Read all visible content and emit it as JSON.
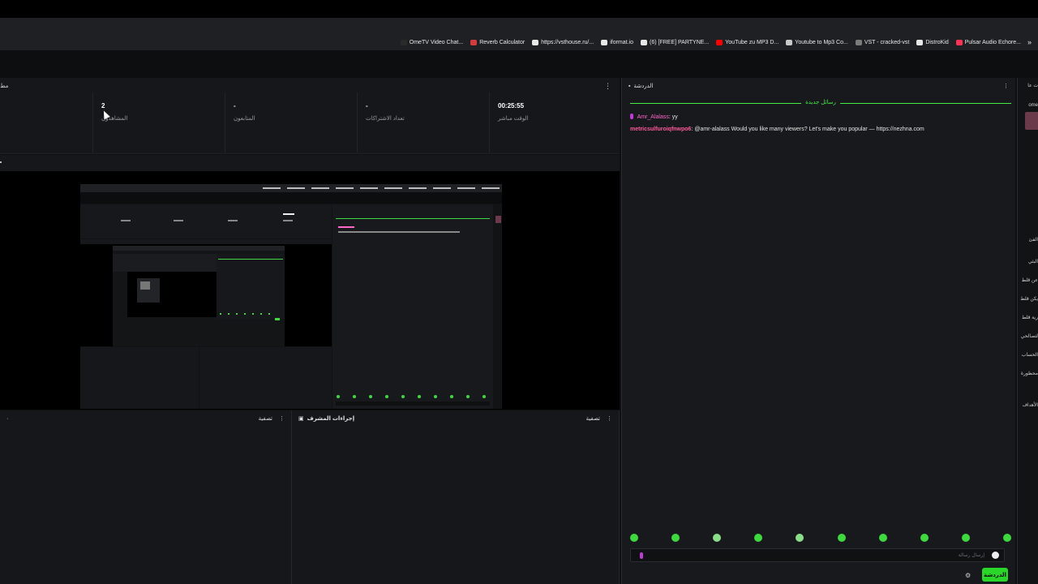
{
  "bookmarks": [
    {
      "label": "OmeTV Video Chat...",
      "icon": "page-icon",
      "color": "#2a2a2a"
    },
    {
      "label": "Reverb Calculator",
      "icon": "calc-icon",
      "color": "#d23c3c"
    },
    {
      "label": "https://vsthouse.ru/...",
      "icon": "globe-icon",
      "color": "#e8e8e8"
    },
    {
      "label": "iformat.io",
      "icon": "globe-icon",
      "color": "#e8e8e8"
    },
    {
      "label": "(6) [FREE] PARTYNE...",
      "icon": "globe-icon",
      "color": "#e8e8e8"
    },
    {
      "label": "YouTube zu MP3 D...",
      "icon": "youtube-icon",
      "color": "#ff0000"
    },
    {
      "label": "Youtube to Mp3 Co...",
      "icon": "y-icon",
      "color": "#c8c8c8"
    },
    {
      "label": "VST - cracked-vst",
      "icon": "vst-icon",
      "color": "#7b7b7b"
    },
    {
      "label": "DistroKid",
      "icon": "globe-icon",
      "color": "#e8e8e8"
    },
    {
      "label": "Pulsar Audio Echore...",
      "icon": "pulsar-icon",
      "color": "#ff3355"
    }
  ],
  "bookmarks_more": "»",
  "stats": {
    "edge_label": "مط",
    "menu": "⋮",
    "items": [
      {
        "value": "2",
        "label": "المشاهدون"
      },
      {
        "value": "-",
        "label": "المتابعون"
      },
      {
        "value": "-",
        "label": "تعداد الاشتراكات"
      },
      {
        "value": "00:25:55",
        "label": "الوقت مباشر"
      }
    ]
  },
  "panels": {
    "left": {
      "filter": "تصفية",
      "menu": "⋮"
    },
    "middle": {
      "title": "إجراءات المشرف",
      "filter": "تصفية",
      "menu": "⋮"
    }
  },
  "chat": {
    "title": "الدردشة",
    "menu": "⋮",
    "new_messages": "رسائل جديدة",
    "messages": [
      {
        "user": "Amr_Alalass",
        "sep": ": ",
        "text": "yy"
      },
      {
        "user": "metricsulfuroiqfnwpo6",
        "sep": ": ",
        "text": "@amr-alalass Would you like many viewers? Let's make you popular — https://nezhna.com"
      }
    ],
    "placeholder": "إرسال رسالة",
    "send": "الدردشة",
    "settings_icon": "⚙"
  },
  "sidebar": {
    "items": [
      "ت عا",
      "ome",
      "الفئ",
      "البثي",
      "عن قلط",
      "يكن قلط",
      "رية قلط",
      "لتصالحي",
      "الحساب",
      "محظورة",
      "الأهداف"
    ]
  },
  "colors": {
    "accent": "#29d629",
    "username": "#ff5a9e",
    "background": "#0e0f11"
  }
}
